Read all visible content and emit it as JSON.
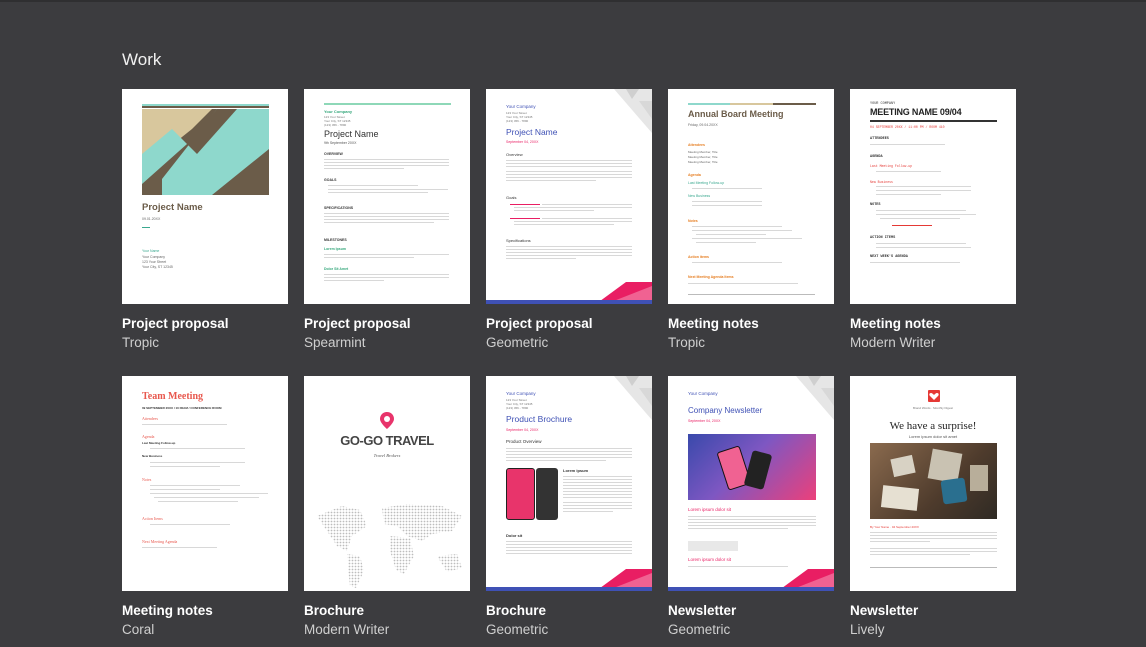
{
  "section": {
    "title": "Work"
  },
  "colors": {
    "background": "#3c3c3f",
    "tropic_teal": "#8ed8cc",
    "tropic_brown": "#6b5c49",
    "spearmint": "#35a77b",
    "geometric_blue": "#3f51b5",
    "geometric_pink": "#e91e63",
    "coral": "#e8584e",
    "brochure_pink": "#e8346b"
  },
  "templates": [
    {
      "title": "Project proposal",
      "subtitle": "Tropic",
      "thumb": {
        "heading": "Project Name",
        "date": "09.01.20XX",
        "lines": [
          "Your Name",
          "Your Company",
          "123 Your Street",
          "Your City, ST 12345"
        ]
      }
    },
    {
      "title": "Project proposal",
      "subtitle": "Spearmint",
      "thumb": {
        "company": "Your Company",
        "address": [
          "123 Your Street",
          "Your City, ST 12345",
          "(123) 456 - 7890"
        ],
        "heading": "Project Name",
        "date": "9th September 20XX",
        "sections": [
          "OVERVIEW",
          "GOALS",
          "SPECIFICATIONS",
          "MILESTONES"
        ],
        "milestones": [
          "Lorem Ipsum",
          "Dolor Sit Amet"
        ]
      }
    },
    {
      "title": "Project proposal",
      "subtitle": "Geometric",
      "thumb": {
        "company": "Your Company",
        "address": [
          "123 Your Street",
          "Your City, ST 12345",
          "(123) 456 - 7890"
        ],
        "heading": "Project Name",
        "date": "September 04, 20XX",
        "sections": [
          "Overview",
          "Goals",
          "Specifications"
        ]
      }
    },
    {
      "title": "Meeting notes",
      "subtitle": "Tropic",
      "thumb": {
        "heading": "Annual Board Meeting",
        "date": "Friday, 09.04.20XX",
        "sections": [
          "Attendees",
          "Agenda",
          "Notes",
          "Action items",
          "Next Meeting Agenda Items"
        ],
        "agenda": [
          "Last Meeting Follow-up",
          "New Business"
        ],
        "attendees": [
          "Meeting Member, Title",
          "Meeting Member, Title",
          "Meeting Member, Title"
        ]
      }
    },
    {
      "title": "Meeting notes",
      "subtitle": "Modern Writer",
      "thumb": {
        "company": "YOUR COMPANY",
        "heading": "MEETING NAME 09/04",
        "date": "04 SEPTEMBER 20XX / 11:00 PM / ROOM 410",
        "sections": [
          "ATTENDEES",
          "AGENDA",
          "NOTES",
          "ACTION ITEMS",
          "NEXT WEEK'S AGENDA"
        ],
        "agenda": [
          "Last Meeting Follow-up",
          "New Business"
        ]
      }
    },
    {
      "title": "Meeting notes",
      "subtitle": "Coral",
      "thumb": {
        "heading": "Team Meeting",
        "date": "09 SEPTEMBER 20XX / 10:00AM / CONFERENCE ROOM",
        "sections": [
          "Attendees",
          "Agenda",
          "Notes",
          "Action Items",
          "Next Meeting Agenda"
        ],
        "agenda": [
          "Last Meeting Follow-up",
          "New Business"
        ]
      }
    },
    {
      "title": "Brochure",
      "subtitle": "Modern Writer",
      "thumb": {
        "heading": "GO-GO TRAVEL",
        "tagline": "Travel Brokers"
      }
    },
    {
      "title": "Brochure",
      "subtitle": "Geometric",
      "thumb": {
        "company": "Your Company",
        "address": [
          "123 Your Street",
          "Your City, ST 12345",
          "(123) 456 - 7890"
        ],
        "heading": "Product Brochure",
        "date": "September 04, 20XX",
        "section": "Product Overview",
        "sub": [
          "Lorem ipsum",
          "Dolor sit"
        ]
      }
    },
    {
      "title": "Newsletter",
      "subtitle": "Geometric",
      "thumb": {
        "company": "Your Company",
        "heading": "Company Newsletter",
        "date": "September 04, 20XX",
        "sub": [
          "Lorem ipsum dolor sit",
          "Lorem ipsum dolor sit"
        ]
      }
    },
    {
      "title": "Newsletter",
      "subtitle": "Lively",
      "thumb": {
        "brand": "Brand Words · Monthly Digest",
        "heading": "We have a surprise!",
        "subheading": "Lorem ipsum dolor sit amet",
        "byline": "By Your Name · 04 September 20XX"
      }
    }
  ]
}
